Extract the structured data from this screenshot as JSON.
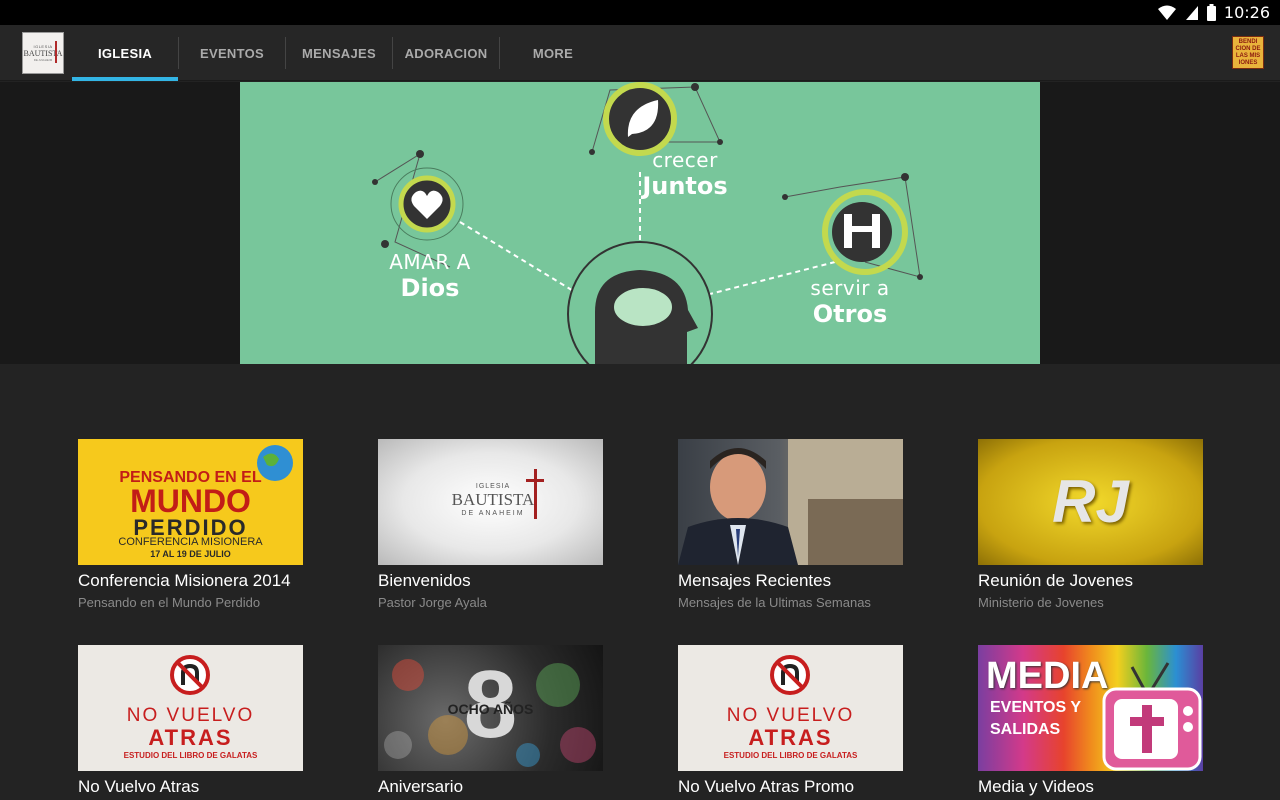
{
  "status": {
    "time": "10:26"
  },
  "app": {
    "logo_lines": [
      "IGLESIA",
      "BAUTISTA",
      "DE ANAHEIM"
    ],
    "tabs": [
      {
        "label": "IGLESIA",
        "active": true
      },
      {
        "label": "EVENTOS",
        "active": false
      },
      {
        "label": "MENSAJES",
        "active": false
      },
      {
        "label": "ADORACION",
        "active": false
      },
      {
        "label": "MORE",
        "active": false
      }
    ],
    "right_logo_lines": [
      "BENDI",
      "CION DE",
      "LAS MIS",
      "IONES"
    ]
  },
  "hero": {
    "amar_small": "AMAR A",
    "amar_big": "Dios",
    "crecer_small": "crecer",
    "crecer_big": "Juntos",
    "servir_small": "servir a",
    "servir_big": "Otros",
    "accent_color": "#78c69b"
  },
  "cards": [
    {
      "title": "Conferencia Misionera 2014",
      "subtitle": "Pensando en el Mundo Perdido",
      "thumb_lines": [
        "PENSANDO EN EL",
        "MUNDO",
        "PERDIDO",
        "CONFERENCIA MISIONERA",
        "17 AL 19 DE JULIO"
      ]
    },
    {
      "title": "Bienvenidos",
      "subtitle": "Pastor Jorge Ayala",
      "thumb_lines": [
        "IGLESIA",
        "BAUTISTA",
        "DE ANAHEIM"
      ]
    },
    {
      "title": "Mensajes Recientes",
      "subtitle": "Mensajes de la Ultimas Semanas"
    },
    {
      "title": "Reunión de Jovenes",
      "subtitle": "Ministerio de Jovenes",
      "thumb_lines": [
        "RJ"
      ]
    },
    {
      "title": "No Vuelvo Atras",
      "subtitle": "",
      "thumb_lines": [
        "NO VUELVO",
        "ATRAS",
        "ESTUDIO DEL LIBRO DE GALATAS"
      ]
    },
    {
      "title": "Aniversario",
      "subtitle": "",
      "thumb_lines": [
        "OCHO AÑOS",
        "8"
      ]
    },
    {
      "title": "No Vuelvo Atras Promo",
      "subtitle": "",
      "thumb_lines": [
        "NO VUELVO",
        "ATRAS",
        "ESTUDIO DEL LIBRO DE GALATAS"
      ]
    },
    {
      "title": "Media y Videos",
      "subtitle": "",
      "thumb_lines": [
        "MEDIA",
        "EVENTOS Y",
        "SALIDAS"
      ]
    }
  ]
}
